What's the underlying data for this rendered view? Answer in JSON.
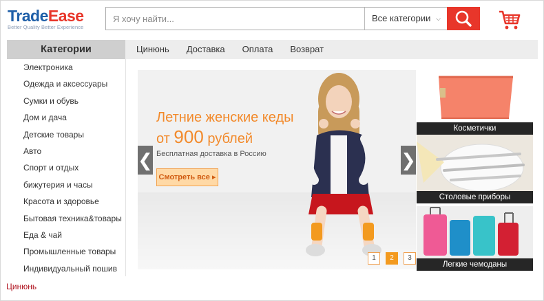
{
  "header": {
    "logo_trade": "Trade",
    "logo_ease": "Ease",
    "logo_tagline": "Better Quality Better Experience",
    "search_placeholder": "Я хочу найти...",
    "search_category": "Все категории"
  },
  "nav": {
    "categories_title": "Категории",
    "links": [
      "Цинюнь",
      "Доставка",
      "Оплата",
      "Возврат"
    ]
  },
  "sidebar": {
    "items": [
      "Электроника",
      "Одежда и аксессуары",
      "Сумки и обувь",
      "Дом и дача",
      "Детские товары",
      "Авто",
      "Спорт и отдых",
      "бижутерия и часы",
      "Красота и здоровье",
      "Бытовая техника&товары",
      "Еда & чай",
      "Промышленные товары",
      "Индивидуальный пошив"
    ]
  },
  "banner": {
    "title": "Летние женские кеды",
    "price_prefix": "от",
    "price_value": "900",
    "price_suffix": "рублей",
    "shipping": "Бесплатная доставка в Россию",
    "button": "Смотреть все ▸",
    "pages": [
      "1",
      "2",
      "3"
    ],
    "active_page": 2
  },
  "promos": [
    {
      "label": "Косметички"
    },
    {
      "label": "Столовые приборы"
    },
    {
      "label": "Легкие чемоданы"
    }
  ],
  "footer": {
    "section_title": "Цинюнь"
  },
  "colors": {
    "brand_red": "#e8362a",
    "brand_blue": "#1f5fa8",
    "accent_orange": "#f28a2b"
  }
}
